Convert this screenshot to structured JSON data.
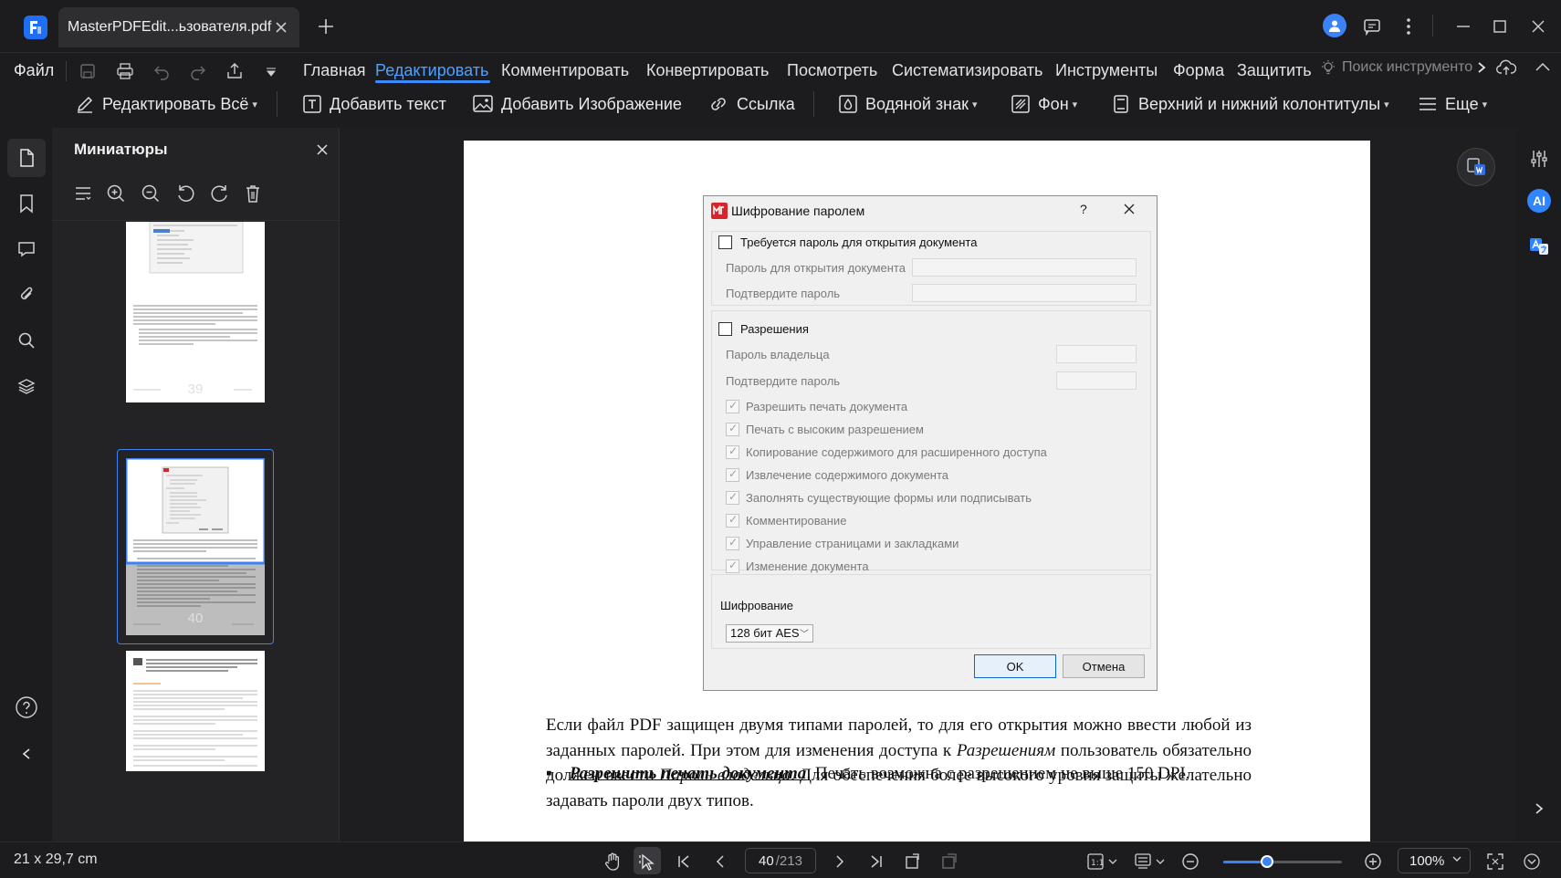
{
  "tab": {
    "title": "MasterPDFEdit...ьзователя.pdf"
  },
  "menu": {
    "file": "Файл",
    "items": [
      "Главная",
      "Редактировать",
      "Комментировать",
      "Конвертировать",
      "Посмотреть",
      "Систематизировать",
      "Инструменты",
      "Форма",
      "Защитить"
    ],
    "active": "Редактировать",
    "tool_search_placeholder": "Поиск инструменто"
  },
  "toolbar": {
    "edit_all": "Редактировать Всё",
    "add_text": "Добавить текст",
    "add_image": "Добавить Изображение",
    "link": "Ссылка",
    "watermark": "Водяной знак",
    "background": "Фон",
    "header_footer": "Верхний и нижний колонтитулы",
    "more": "Еще"
  },
  "thumbnails": {
    "title": "Миниатюры",
    "pages": [
      "39",
      "40"
    ]
  },
  "right_rail": {
    "ai": "AI"
  },
  "dialog": {
    "title": "Шифрование паролем",
    "help": "?",
    "require_open_password": "Требуется пароль для открытия документа",
    "open_password": "Пароль для открытия документа",
    "confirm_password": "Подтвердите пароль",
    "permissions": "Разрешения",
    "owner_password": "Пароль владельца",
    "confirm_owner_password": "Подтвердите пароль",
    "permission_items": [
      "Разрешить печать документа",
      "Печать с высоким разрешением",
      "Копирование содержимого для расширенного доступа",
      "Извлечение содержимого документа",
      "Заполнять существующие формы или подписывать",
      "Комментирование",
      "Управление страницами и закладками",
      "Изменение документа"
    ],
    "encryption_label": "Шифрование",
    "encryption_value": "128 бит AES",
    "ok": "OK",
    "cancel": "Отмена"
  },
  "page_text": {
    "p1": "Если файл PDF защищен двумя типами паролей, то для его открытия можно ввести любой из заданных паролей. При этом для изменения доступа к ",
    "p1_italic1": "Разрешениям",
    "p1_b": " пользователь обязательно должен ввести ",
    "p1_italic2": "Пароль владельца",
    "p1_c": ". Для обеспечения более высокого уровня защиты желательно задавать пароли двух типов.",
    "bullet_bold": "Разрешить печать документа",
    "bullet_rest": ". Печать возможна с разрешением не выше 150 DPI."
  },
  "status": {
    "page_size": "21 x 29,7 cm",
    "current_page": "40",
    "total_pages": "/213",
    "zoom": "100%",
    "zoom_fraction": 0.37
  }
}
